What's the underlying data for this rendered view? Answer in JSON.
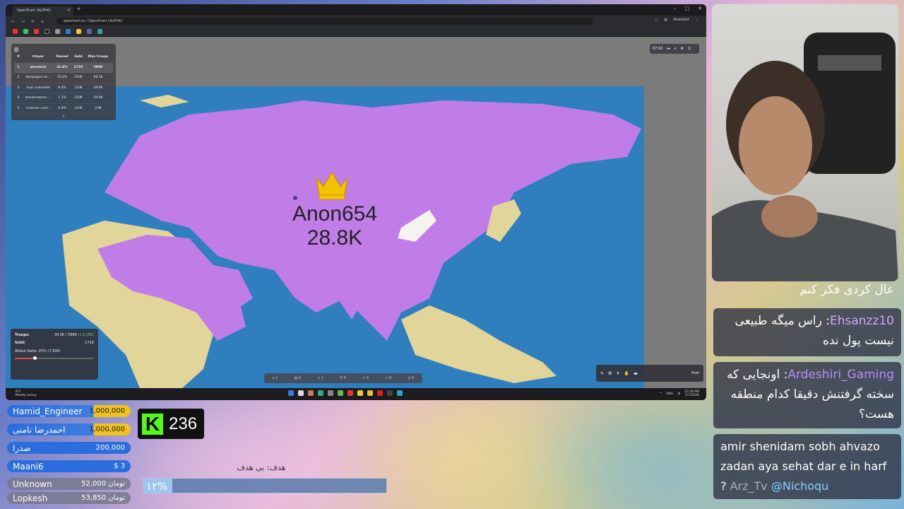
{
  "browser": {
    "tab_title": "OpenFront (ALPHA)",
    "url": "openfront.io / OpenFront (ALPHA)",
    "assistant_label": "Assistant"
  },
  "game": {
    "leaderboard": {
      "headers": [
        "#",
        "Player",
        "Owned",
        "Gold",
        "Max troops"
      ],
      "rows": [
        {
          "rank": "1",
          "name": "Anon654",
          "owned": "41.6%",
          "gold": "171K",
          "max": "399K"
        },
        {
          "rank": "2",
          "name": "Norwegian Ac...",
          "owned": "15.0%",
          "gold": "210K",
          "max": "69.1K"
        },
        {
          "rank": "3",
          "name": "Yuan Sultanate",
          "owned": "8.4%",
          "gold": "210K",
          "max": "49.6K"
        },
        {
          "rank": "4",
          "name": "Kanem-Bornu ...",
          "owned": "1.1%",
          "gold": "210K",
          "max": "16.9K"
        },
        {
          "rank": "5",
          "name": "Thracian Cant...",
          "owned": "0.0%",
          "gold": "210K",
          "max": "3.9K"
        }
      ]
    },
    "timer": "07:02",
    "player_label": {
      "name": "Anon654",
      "troops": "28.8K"
    },
    "troops_panel": {
      "troops_label": "Troops:",
      "troops_value": "30.0K / 399K",
      "troops_rate": "(+3.15K)",
      "gold_label": "Gold:",
      "gold_value": "171K",
      "attack_ratio": "Attack Ratio: 25% (7.50K)",
      "attack_ratio_value": 0.25
    },
    "build_tools": {
      "hide_label": "Hide"
    },
    "unit_counts": [
      "1",
      "0",
      "1",
      "0",
      "0",
      "0",
      "0"
    ]
  },
  "taskbar": {
    "weather_temp": "8°C",
    "weather_desc": "Mostly sunny",
    "lang": "ENG",
    "time": "12:29 PM",
    "date": "1/7/2026"
  },
  "webcam_caption": "عال کردی فکر کنم",
  "chat": [
    {
      "user": "Ehsanzz10",
      "text": "راس میگه طبیعی نیست پول نده"
    },
    {
      "user": "Ardeshiri_Gaming",
      "text": "اونجایی که سخته گرفتنش دقیقا کدام منطقه هست؟"
    },
    {
      "user": "Arz_Tv",
      "text": "amir shenidam sobh ahvazo zadan aya sehat dar e in harf ?",
      "mention": "@Nichoqu"
    }
  ],
  "donations": [
    {
      "name": "Hamid_Engineer",
      "amount": "1,000,000",
      "style": "gold"
    },
    {
      "name": "احمدرضا نامنی",
      "amount": "1,000,000",
      "style": "gold"
    },
    {
      "name": "صدرا",
      "amount": "200,000",
      "style": "blue"
    },
    {
      "name": "Maani6",
      "amount": "$ 3",
      "style": "blue"
    },
    {
      "name": "Unknown",
      "amount": "52,000 تومان",
      "style": "grey"
    },
    {
      "name": "Lopkesh",
      "amount": "53,850 تومان",
      "style": "grey"
    }
  ],
  "kick": {
    "count": "236",
    "logo": "K"
  },
  "goal": {
    "label": "هدف: بی هدف",
    "percent_text": "۱۲%",
    "progress": 0.12
  },
  "colors": {
    "territory": "#c07de8",
    "ocean": "#2f7fbf",
    "land": "#e2d59a",
    "kick_green": "#53fc18"
  }
}
